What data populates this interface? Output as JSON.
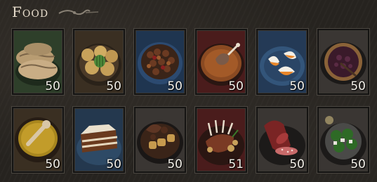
{
  "header": {
    "title": "Food"
  },
  "colors": {
    "panel": "#26231f",
    "title": "#e6dccb",
    "quantity": "#f2efe8"
  },
  "items": [
    {
      "name": "bread-item",
      "icon": "bread-icon",
      "qty": "50",
      "bg": "#2e3f2a"
    },
    {
      "name": "potatoes-item",
      "icon": "potatoes-bowl-icon",
      "qty": "50",
      "bg": "#3a2f22"
    },
    {
      "name": "bean-stew-item",
      "icon": "bean-stew-icon",
      "qty": "50",
      "bg": "#1f3550"
    },
    {
      "name": "meat-soup-item",
      "icon": "meat-soup-icon",
      "qty": "50",
      "bg": "#4a1c1c"
    },
    {
      "name": "eggs-item",
      "icon": "poached-eggs-icon",
      "qty": "50",
      "bg": "#243a56"
    },
    {
      "name": "berry-pie-item",
      "icon": "berry-pie-icon",
      "qty": "50",
      "bg": "#3a3633"
    },
    {
      "name": "broth-item",
      "icon": "broth-icon",
      "qty": "50",
      "bg": "#3a2f22"
    },
    {
      "name": "cake-item",
      "icon": "cake-slice-icon",
      "qty": "50",
      "bg": "#24384e"
    },
    {
      "name": "roast-item",
      "icon": "roast-potatoes-icon",
      "qty": "50",
      "bg": "#3a3633"
    },
    {
      "name": "roast-ribs-item",
      "icon": "rack-of-ribs-icon",
      "qty": "51",
      "bg": "#4a1c1c"
    },
    {
      "name": "sausage-item",
      "icon": "sausage-icon",
      "qty": "50",
      "bg": "#3a3633"
    },
    {
      "name": "salad-item",
      "icon": "salad-icon",
      "qty": "50",
      "bg": "#3a3633"
    }
  ]
}
